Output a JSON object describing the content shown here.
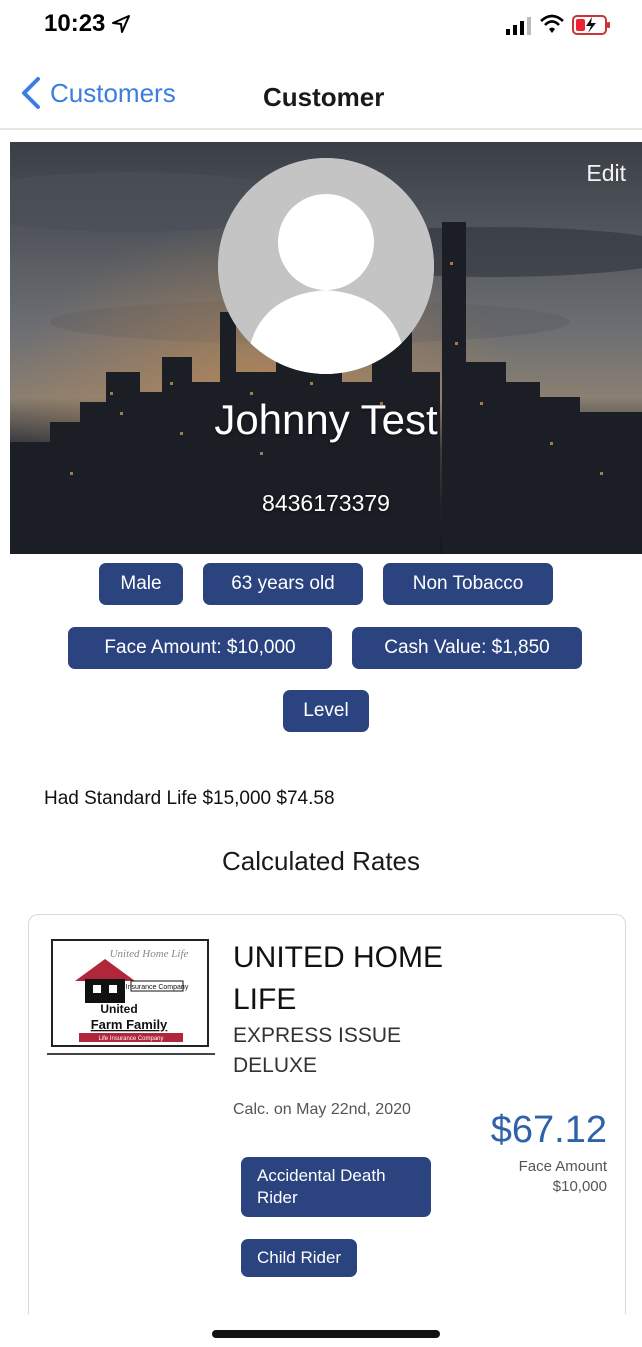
{
  "status_bar": {
    "time": "10:23"
  },
  "nav": {
    "back_label": "Customers",
    "title": "Customer"
  },
  "hero": {
    "edit_label": "Edit",
    "name": "Johnny Test",
    "phone": "8436173379"
  },
  "chips": {
    "gender": "Male",
    "age": "63 years old",
    "tobacco": "Non Tobacco",
    "face_amount": "Face Amount: $10,000",
    "cash_value": "Cash Value: $1,850",
    "plan_type": "Level"
  },
  "summary_line": "Had Standard Life $15,000 $74.58",
  "section_title": "Calculated Rates",
  "rate_card": {
    "company_name": "UNITED HOME LIFE",
    "product_name": "EXPRESS  ISSUE DELUXE",
    "calc_date": "Calc. on May 22nd, 2020",
    "price": "$67.12",
    "face_label": "Face Amount",
    "face_value": "$10,000",
    "riders": [
      "Accidental Death Rider",
      "Child Rider"
    ],
    "logo": {
      "top_text": "United Home Life",
      "insurance_text": "Insurance Company",
      "brand_line1": "United",
      "brand_line2": "Farm Family",
      "brand_sub": "Life Insurance Company"
    }
  },
  "colors": {
    "accent": "#2b4480",
    "link": "#3b7ee0",
    "price": "#2f62a8"
  }
}
